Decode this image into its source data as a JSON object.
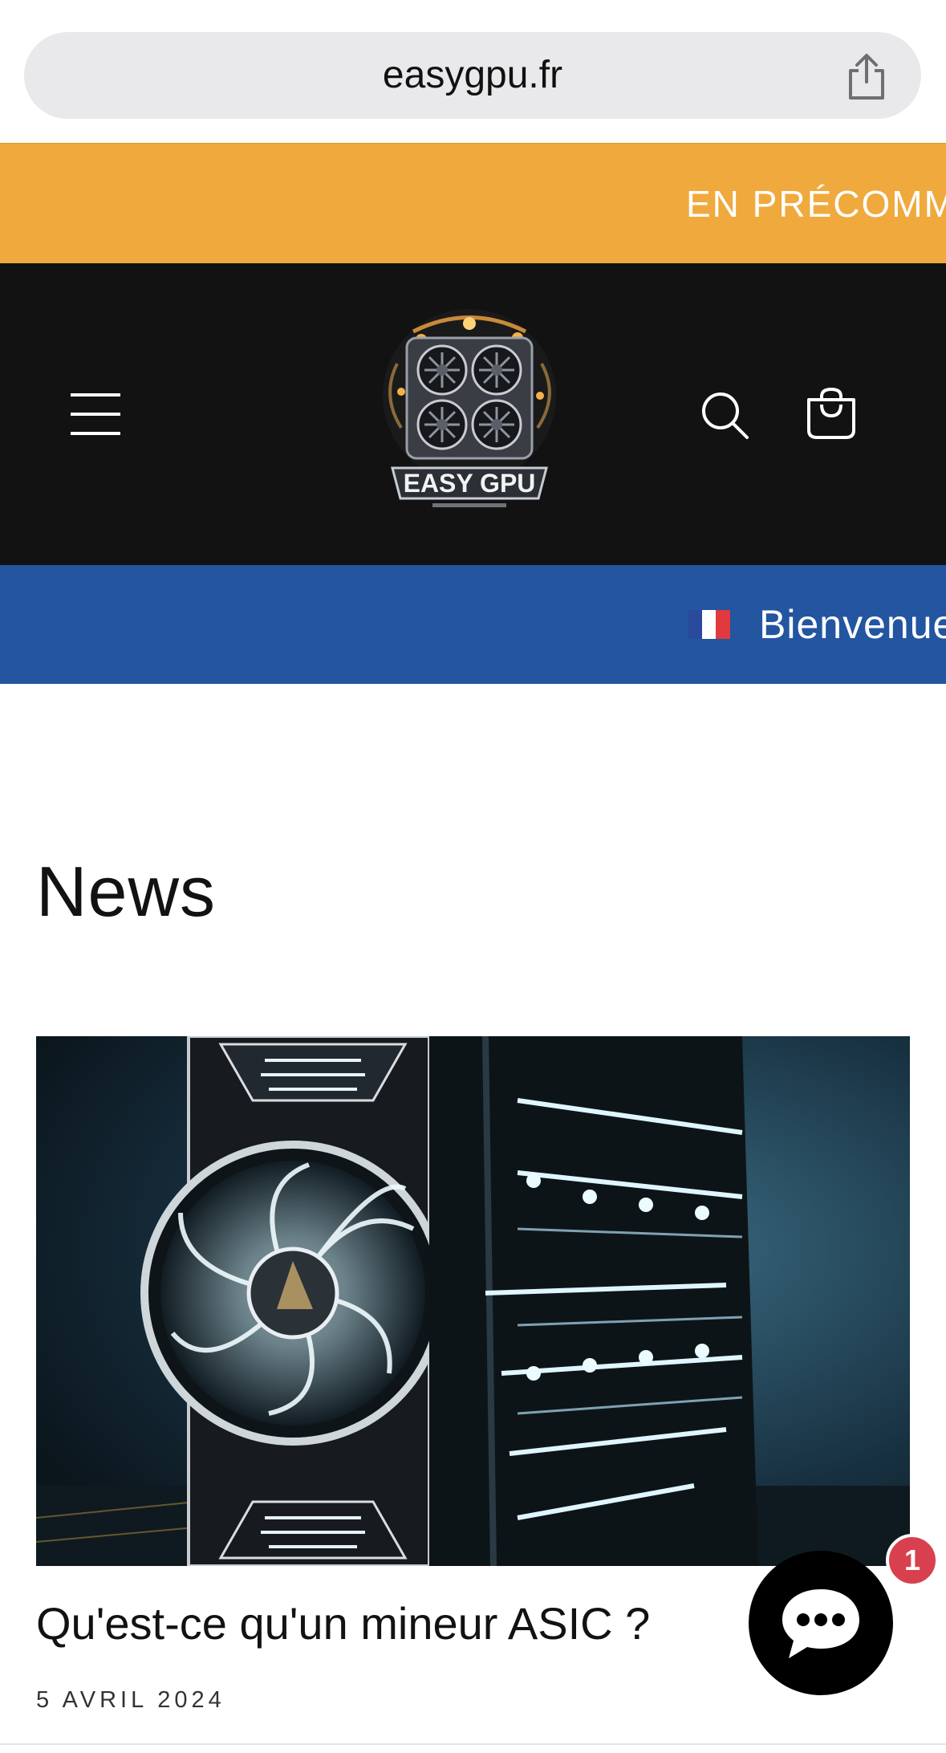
{
  "browser": {
    "url": "easygpu.fr",
    "share_icon": "share-icon"
  },
  "announcement": {
    "text": "EN PRÉCOMMANDE",
    "color": "#f0a93d"
  },
  "header": {
    "menu_icon": "hamburger-menu-icon",
    "logo_text": "EASY GPU",
    "search_icon": "search-icon",
    "cart_icon": "cart-bag-icon",
    "background": "#121212"
  },
  "welcome_bar": {
    "flag": "french-flag-icon",
    "text": "Bienvenue",
    "color": "#2355a1"
  },
  "main": {
    "title": "News",
    "articles": [
      {
        "title": "Qu'est-ce qu'un mineur ASIC ?",
        "date": "5 AVRIL 2024",
        "image": "gpu-card-glowing-fan-image"
      }
    ]
  },
  "chat": {
    "icon": "chat-bubble-icon",
    "badge_count": "1",
    "badge_color": "#d8404f"
  }
}
